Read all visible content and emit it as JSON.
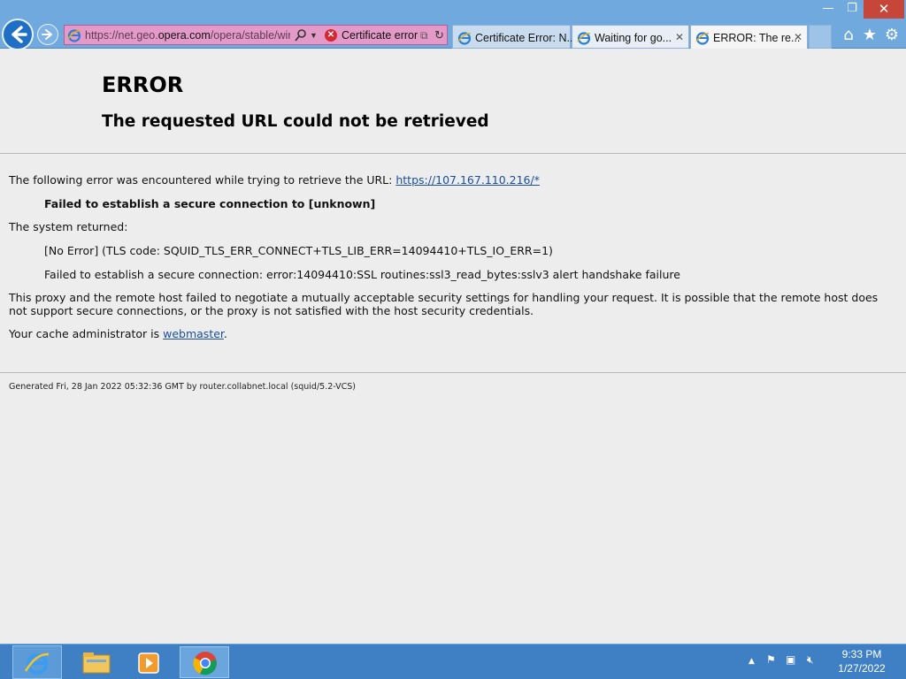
{
  "window": {
    "minimize_glyph": "—",
    "maximize_glyph": "❐",
    "close_glyph": "✕"
  },
  "addressbar": {
    "url_prefix": "https://net.geo.",
    "url_domain": "opera.com",
    "url_suffix": "/opera/stable/wir",
    "certificate_label": "Certificate error"
  },
  "tabs": [
    {
      "title": "Certificate Error: N..."
    },
    {
      "title": "Waiting for go..."
    },
    {
      "title": "ERROR: The re..."
    }
  ],
  "page": {
    "title": "ERROR",
    "subtitle": "The requested URL could not be retrieved",
    "intro_text": "The following error was encountered while trying to retrieve the URL: ",
    "intro_link": "https://107.167.110.216/*",
    "failure_line": "Failed to establish a secure connection to [unknown]",
    "system_returned": "The system returned:",
    "tls_code": "[No Error] (TLS code: SQUID_TLS_ERR_CONNECT+TLS_LIB_ERR=14094410+TLS_IO_ERR=1)",
    "ssl_error": "Failed to establish a secure connection: error:14094410:SSL routines:ssl3_read_bytes:sslv3 alert handshake failure",
    "explanation": "This proxy and the remote host failed to negotiate a mutually acceptable security settings for handling your request. It is possible that the remote host does not support secure connections, or the proxy is not satisfied with the host security credentials.",
    "admin_prefix": "Your cache administrator is ",
    "admin_link": "webmaster",
    "admin_suffix": ".",
    "footer": "Generated Fri, 28 Jan 2022 05:32:36 GMT by router.collabnet.local (squid/5.2-VCS)"
  },
  "taskbar": {
    "time": "9:33 PM",
    "date": "1/27/2022"
  },
  "colors": {
    "chrome_blue": "#6fa9de",
    "address_error_pink": "#e49ac9",
    "link_blue": "#1b4f9a",
    "taskbar_blue": "#3f7fc3"
  }
}
